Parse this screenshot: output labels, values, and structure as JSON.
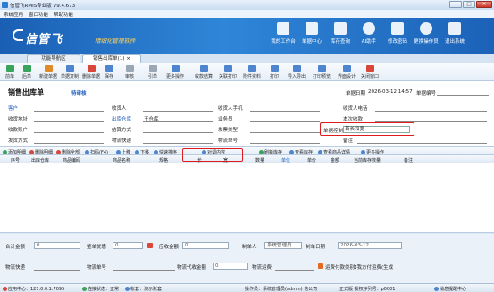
{
  "window": {
    "title": "信管飞RMIS专业版 V9.4.673"
  },
  "menu": [
    "系统应用",
    "窗口功能",
    "帮助功能"
  ],
  "banner": {
    "logo": "信管飞",
    "slogan": "精细化管理软件",
    "nav": [
      "我的工作台",
      "单据中心",
      "库存查询",
      "AI助手",
      "修改密码",
      "更换操作员",
      "退出系统"
    ]
  },
  "tabs": [
    {
      "label": "功能导航区"
    },
    {
      "label": "销售出库单(1)",
      "close": "×"
    }
  ],
  "toolbar": [
    "前单",
    "后单",
    "新建单据",
    "单据复制",
    "删除单据",
    "保存",
    "审核",
    "引单",
    "更多操作",
    "收款结算",
    "关联打印",
    "附件资料",
    "打印",
    "导入导出",
    "打印预览",
    "界面设计",
    "关闭窗口"
  ],
  "form": {
    "title": "销售出库单",
    "status": "待审核",
    "fields": {
      "customer": "客户",
      "receiver": "收货人",
      "receiver_phone": "收货人手机",
      "receiver_tel": "收货人电话",
      "ship_address": "收货地址",
      "out_warehouse": "出库仓库",
      "out_warehouse_value": "王仓库",
      "salesman": "业务员",
      "current_receipt": "本次收款",
      "receipt_account": "收款账户",
      "settle_method": "结算方式",
      "invoice_type": "发票类型",
      "order_controller": "单据控制",
      "order_controller_value": "首长和宽",
      "ship_method": "发货方式",
      "logistics_express": "物流快递",
      "logistics_no": "物流单号",
      "remark": "备注",
      "doc_date_label": "单据日期",
      "doc_date": "2026-03-12 14:57",
      "doc_no_label": "单据编号"
    }
  },
  "grid_toolbar": [
    "添加明细",
    "删除明细",
    "删除全部",
    "扫码(F4)",
    "上移",
    "下移",
    "快速排序",
    "对调内容",
    "刷新库存",
    "查看库存",
    "查看商品详情",
    "更多操作"
  ],
  "grid_columns": [
    "序号",
    "出库仓库",
    "商品编码",
    "商品名称",
    "规格",
    "长",
    "宽",
    "数量",
    "单位",
    "单价",
    "金额",
    "当前库存数量",
    "备注"
  ],
  "footer": {
    "total_amount_label": "合计金额",
    "total_amount": "0",
    "discount_label": "整单优惠",
    "discount": "0",
    "receivable_label": "应收金额",
    "receivable": "0",
    "creator_label": "制单人",
    "creator": "系统管理员",
    "create_date_label": "制单日期",
    "create_date": "2026-03-12",
    "express_label": "物流快递",
    "express_no_label": "物流单号",
    "collect_label": "物流代收金额",
    "collect": "0",
    "freight_label": "物流运费",
    "freight_option": "运费付款类别",
    "freight_option_value": "1我方付运费(生成"
  },
  "status": {
    "server": "应用中心：127.0.0.1:7095",
    "conn": "连接状态：正常",
    "tenant": "帐套：演示账套",
    "operator": "操作员：系统管理员(admin) 信公司",
    "edition": "正式版 授权序列号：p0001",
    "msg": "消息提醒中心"
  }
}
